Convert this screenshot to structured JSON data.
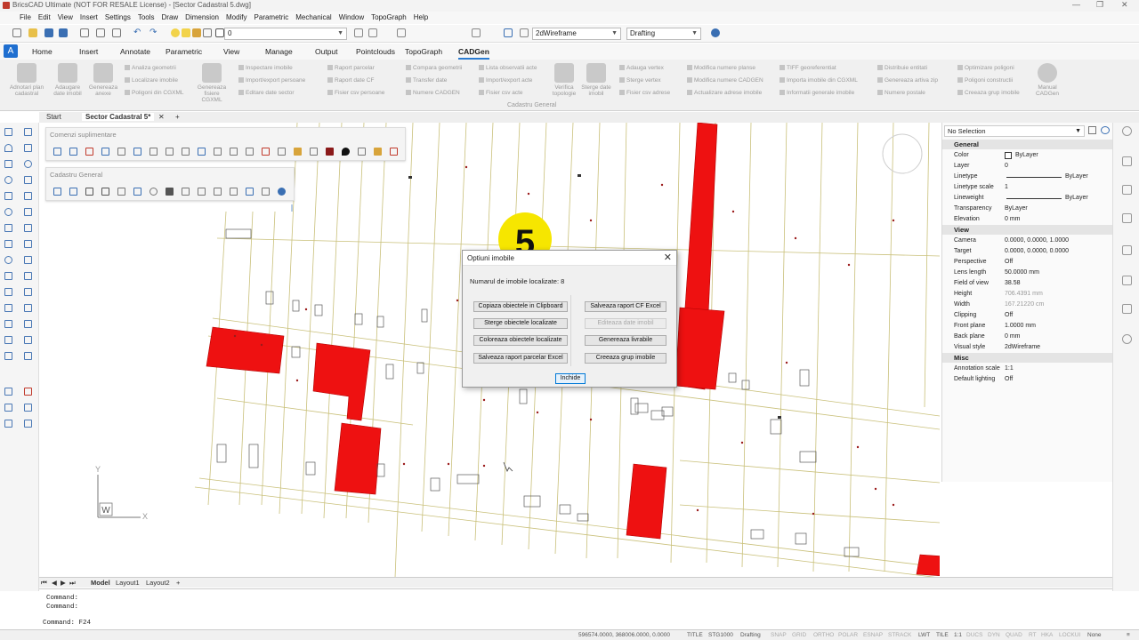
{
  "window": {
    "title": "BricsCAD Ultimate (NOT FOR RESALE License) - [Sector Cadastral 5.dwg]"
  },
  "menu": [
    "File",
    "Edit",
    "View",
    "Insert",
    "Settings",
    "Tools",
    "Draw",
    "Dimension",
    "Modify",
    "Parametric",
    "Mechanical",
    "Window",
    "TopoGraph",
    "Help"
  ],
  "toolbar": {
    "layer_value": "0",
    "visual_style": "2dWireframe",
    "workspace": "Drafting"
  },
  "ribbon_tabs": [
    "Home",
    "Insert",
    "Annotate",
    "Parametric",
    "View",
    "Manage",
    "Output",
    "Pointclouds",
    "TopoGraph",
    "CADGen"
  ],
  "ribbon_active": "CADGen",
  "ribbon": {
    "big_buttons": [
      {
        "label": "Adnotari plan cadastral"
      },
      {
        "label": "Adaugare date imobil"
      },
      {
        "label": "Genereaza anexe"
      },
      {
        "label": "Genereaza fisiere CGXML"
      },
      {
        "label": "Verifica topologie"
      },
      {
        "label": "Sterge date imobil"
      },
      {
        "label": "Manual CADGen"
      }
    ],
    "small_buttons": [
      "Analiza geometrii",
      "Localizare imobile",
      "Poligoni din CGXML",
      "Inspectare imobile",
      "Import/export persoane",
      "Editare date sector",
      "Raport parcelar",
      "Raport date CF",
      "Fisier csv persoane",
      "Compara geometrii",
      "Transfer date",
      "Numere CADGEN",
      "Lista observatii acte",
      "Import/export acte",
      "Fisier csv acte",
      "Adauga vertex",
      "Sterge vertex",
      "Fisier csv adrese",
      "Modifica numere planse",
      "Modifica numere CADGEN",
      "Actualizare adrese imobile",
      "TIFF georeferentiat",
      "Importa imobile din CGXML",
      "Informatii generale imobile",
      "Distribuie entitati",
      "Genereaza artiva zip",
      "Numere postale",
      "Optimizare poligoni",
      "Poligoni constructii",
      "Creeaza grup imobile"
    ],
    "group_label": "Cadastru General"
  },
  "doc_tabs": [
    "Start",
    "Sector Cadastral 5*"
  ],
  "palettes": {
    "extra": {
      "title": "Comenzi suplimentare"
    },
    "general": {
      "title": "Cadastru General"
    }
  },
  "canvas": {
    "sector_number": "5",
    "ucs_x": "X",
    "ucs_y": "Y",
    "ucs_w": "W"
  },
  "dialog": {
    "title": "Optiuni imobile",
    "found_label": "Numarul de imobile localizate: 8",
    "buttons": {
      "copy": "Copiaza obiectele in Clipboard",
      "delete": "Sterge obiectele localizate",
      "color": "Coloreaza obiectele localizate",
      "save_parcel": "Salveaza raport parcelar Excel",
      "save_cf": "Salveaza raport CF Excel",
      "edit": "Editeaza date imobil",
      "deliverables": "Genereaza livrabile",
      "group": "Creeaza grup imobile",
      "close": "Inchide"
    }
  },
  "properties": {
    "selection": "No Selection",
    "categories": {
      "general": "General",
      "view": "View",
      "misc": "Misc"
    },
    "general": [
      {
        "k": "Color",
        "v": "ByLayer"
      },
      {
        "k": "Layer",
        "v": "0"
      },
      {
        "k": "Linetype",
        "v": "ByLayer"
      },
      {
        "k": "Linetype scale",
        "v": "1"
      },
      {
        "k": "Lineweight",
        "v": "ByLayer"
      },
      {
        "k": "Transparency",
        "v": "ByLayer"
      },
      {
        "k": "Elevation",
        "v": "0 mm"
      }
    ],
    "view": [
      {
        "k": "Camera",
        "v": "0.0000, 0.0000, 1.0000"
      },
      {
        "k": "Target",
        "v": "0.0000, 0.0000, 0.0000"
      },
      {
        "k": "Perspective",
        "v": "Off"
      },
      {
        "k": "Lens length",
        "v": "50.0000 mm"
      },
      {
        "k": "Field of view",
        "v": "38.58"
      },
      {
        "k": "Height",
        "v": "706.4391 mm"
      },
      {
        "k": "Width",
        "v": "167.21220 cm"
      },
      {
        "k": "Clipping",
        "v": "Off"
      },
      {
        "k": "Front plane",
        "v": "1.0000 mm"
      },
      {
        "k": "Back plane",
        "v": "0 mm"
      },
      {
        "k": "Visual style",
        "v": "2dWireframe"
      }
    ],
    "misc": [
      {
        "k": "Annotation scale",
        "v": "1:1"
      },
      {
        "k": "Default lighting",
        "v": "Off"
      }
    ]
  },
  "layout_tabs": [
    "Model",
    "Layout1",
    "Layout2"
  ],
  "command": {
    "lines": [
      "Command:",
      "Command:"
    ],
    "prompt": "Command: F24"
  },
  "status": {
    "coords": "596574.0000, 368006.0000, 0.0000",
    "items": [
      "TITLE",
      "STG1000",
      "Drafting",
      "SNAP",
      "GRID",
      "ORTHO",
      "POLAR",
      "ESNAP",
      "STRACK",
      "LWT",
      "TILE",
      "1:1",
      "DUCS",
      "DYN",
      "QUAD",
      "RT",
      "HKA",
      "LOCKUI",
      "None"
    ]
  }
}
